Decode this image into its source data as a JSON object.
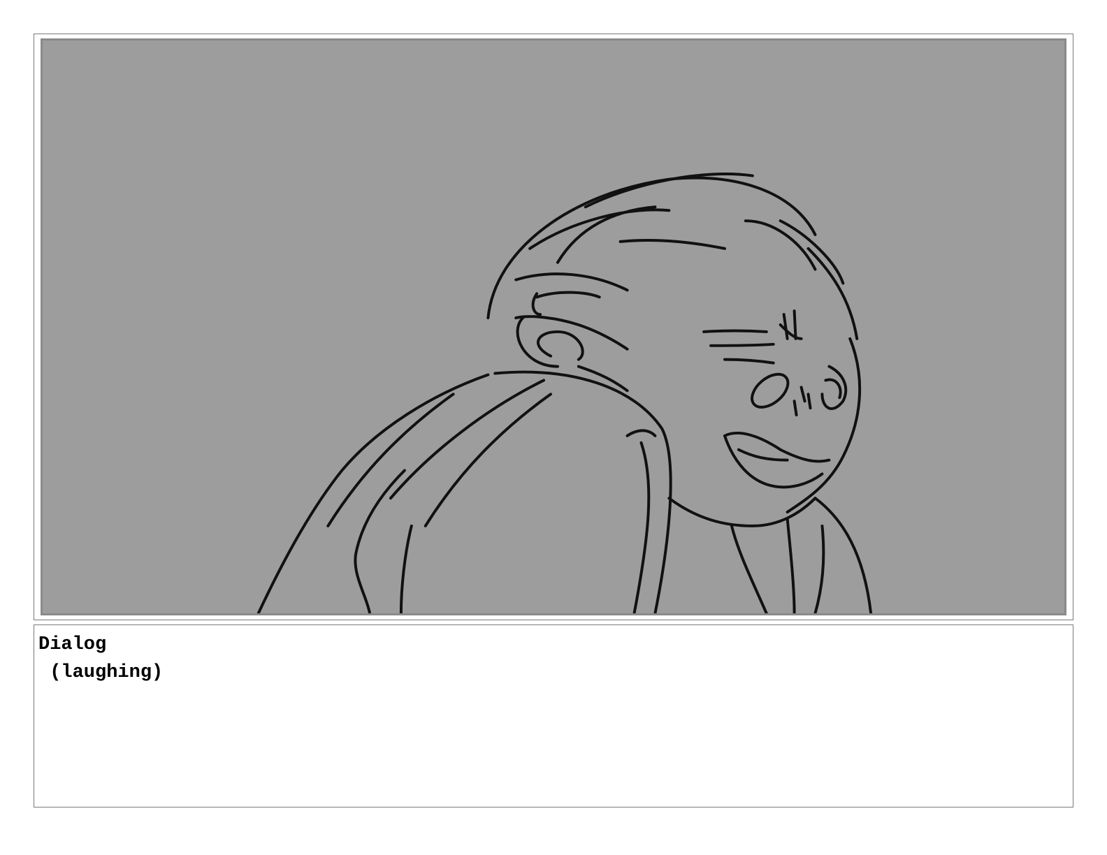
{
  "panel": {
    "background_color": "#9d9d9d",
    "line_color": "#111111",
    "illustration": "rough storyboard sketch of a laughing figure leaning head on shoulder"
  },
  "dialog": {
    "heading": "Dialog",
    "lines": [
      " (laughing)"
    ]
  }
}
